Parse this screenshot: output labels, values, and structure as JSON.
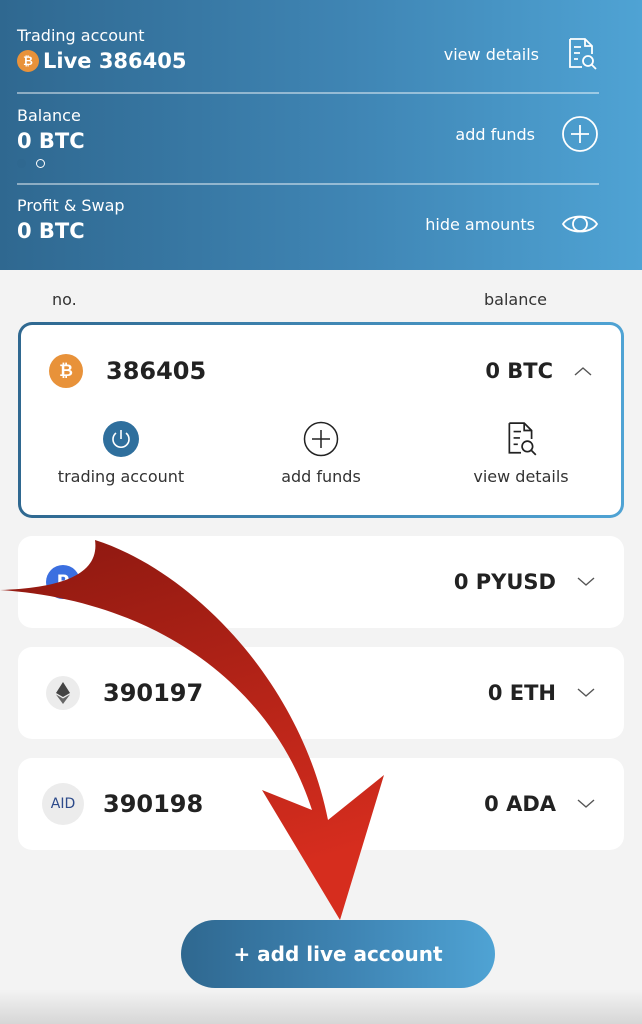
{
  "header": {
    "trading_label": "Trading account",
    "trading_value": "Live 386405",
    "view_details": "view details",
    "balance_label": "Balance",
    "balance_value": "0 BTC",
    "add_funds": "add funds",
    "profit_label": "Profit & Swap",
    "profit_value": "0 BTC",
    "hide_amounts": "hide amounts",
    "btc_glyph": "₿"
  },
  "columns": {
    "no": "no.",
    "balance": "balance"
  },
  "accounts": [
    {
      "number": "386405",
      "balance": "0 BTC",
      "coin": "btc",
      "glyph": "₿",
      "expanded": true
    },
    {
      "number": "",
      "balance": "0 PYUSD",
      "coin": "pyusd",
      "glyph": "P",
      "expanded": false
    },
    {
      "number": "390197",
      "balance": "0 ETH",
      "coin": "eth",
      "glyph": "◆",
      "expanded": false
    },
    {
      "number": "390198",
      "balance": "0 ADA",
      "coin": "ada",
      "glyph": "AID",
      "expanded": false
    }
  ],
  "expanded_actions": {
    "trading_account": "trading account",
    "add_funds": "add funds",
    "view_details": "view details"
  },
  "add_live_account": "+ add live account",
  "colors": {
    "brand_dark": "#2f6890",
    "brand_light": "#4fa3d4",
    "btc": "#e8923a",
    "pyusd": "#3b6fe0",
    "arrow": "#c4261c"
  }
}
